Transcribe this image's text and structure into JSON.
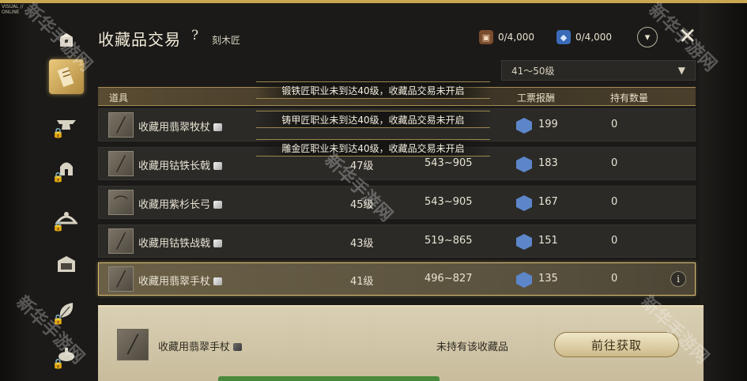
{
  "corner_label": [
    "VISUAL //",
    "ONLINE"
  ],
  "header": {
    "title": "收藏品交易",
    "help": "?",
    "subtitle": "刻木匠",
    "currency_brown": "0/4,000",
    "currency_blue": "0/4,000"
  },
  "level_filter": {
    "selected": "41～50级"
  },
  "columns": {
    "item": "道具",
    "reward": "工票报酬",
    "held": "持有数量"
  },
  "rows": [
    {
      "name": "收藏用翡翠牧杖",
      "level": "",
      "range": "",
      "reward": "199",
      "held": "0"
    },
    {
      "name": "收藏用钴铁长戟",
      "level": "47级",
      "range": "543~905",
      "reward": "183",
      "held": "0"
    },
    {
      "name": "收藏用紫杉长弓",
      "level": "45级",
      "range": "543~905",
      "reward": "167",
      "held": "0"
    },
    {
      "name": "收藏用钴铁战戟",
      "level": "43级",
      "range": "519~865",
      "reward": "151",
      "held": "0"
    },
    {
      "name": "收藏用翡翠手杖",
      "level": "41级",
      "range": "496~827",
      "reward": "135",
      "held": "0"
    }
  ],
  "toasts": [
    "锻铁匠职业未到达40级，收藏品交易未开启",
    "铸甲匠职业未到达40级，收藏品交易未开启",
    "雕金匠职业未到达40级，收藏品交易未开启"
  ],
  "selected_item": {
    "name": "收藏用翡翠手杖",
    "status": "未持有该收藏品",
    "button": "前往获取"
  },
  "watermark": "新华手游网",
  "icons": {
    "sidebar": [
      "box-icon",
      "scroll-icon",
      "anvil-icon",
      "helmet-icon",
      "tiara-icon",
      "tapestry-icon",
      "leaf-icon",
      "cooking-icon"
    ],
    "currency": [
      "brown-scrip-icon",
      "blue-scrip-icon"
    ]
  },
  "colors": {
    "accent_gold": "#c9a650",
    "scrip_blue": "#5d86c9",
    "panel_cream": "#d9cfb3"
  }
}
